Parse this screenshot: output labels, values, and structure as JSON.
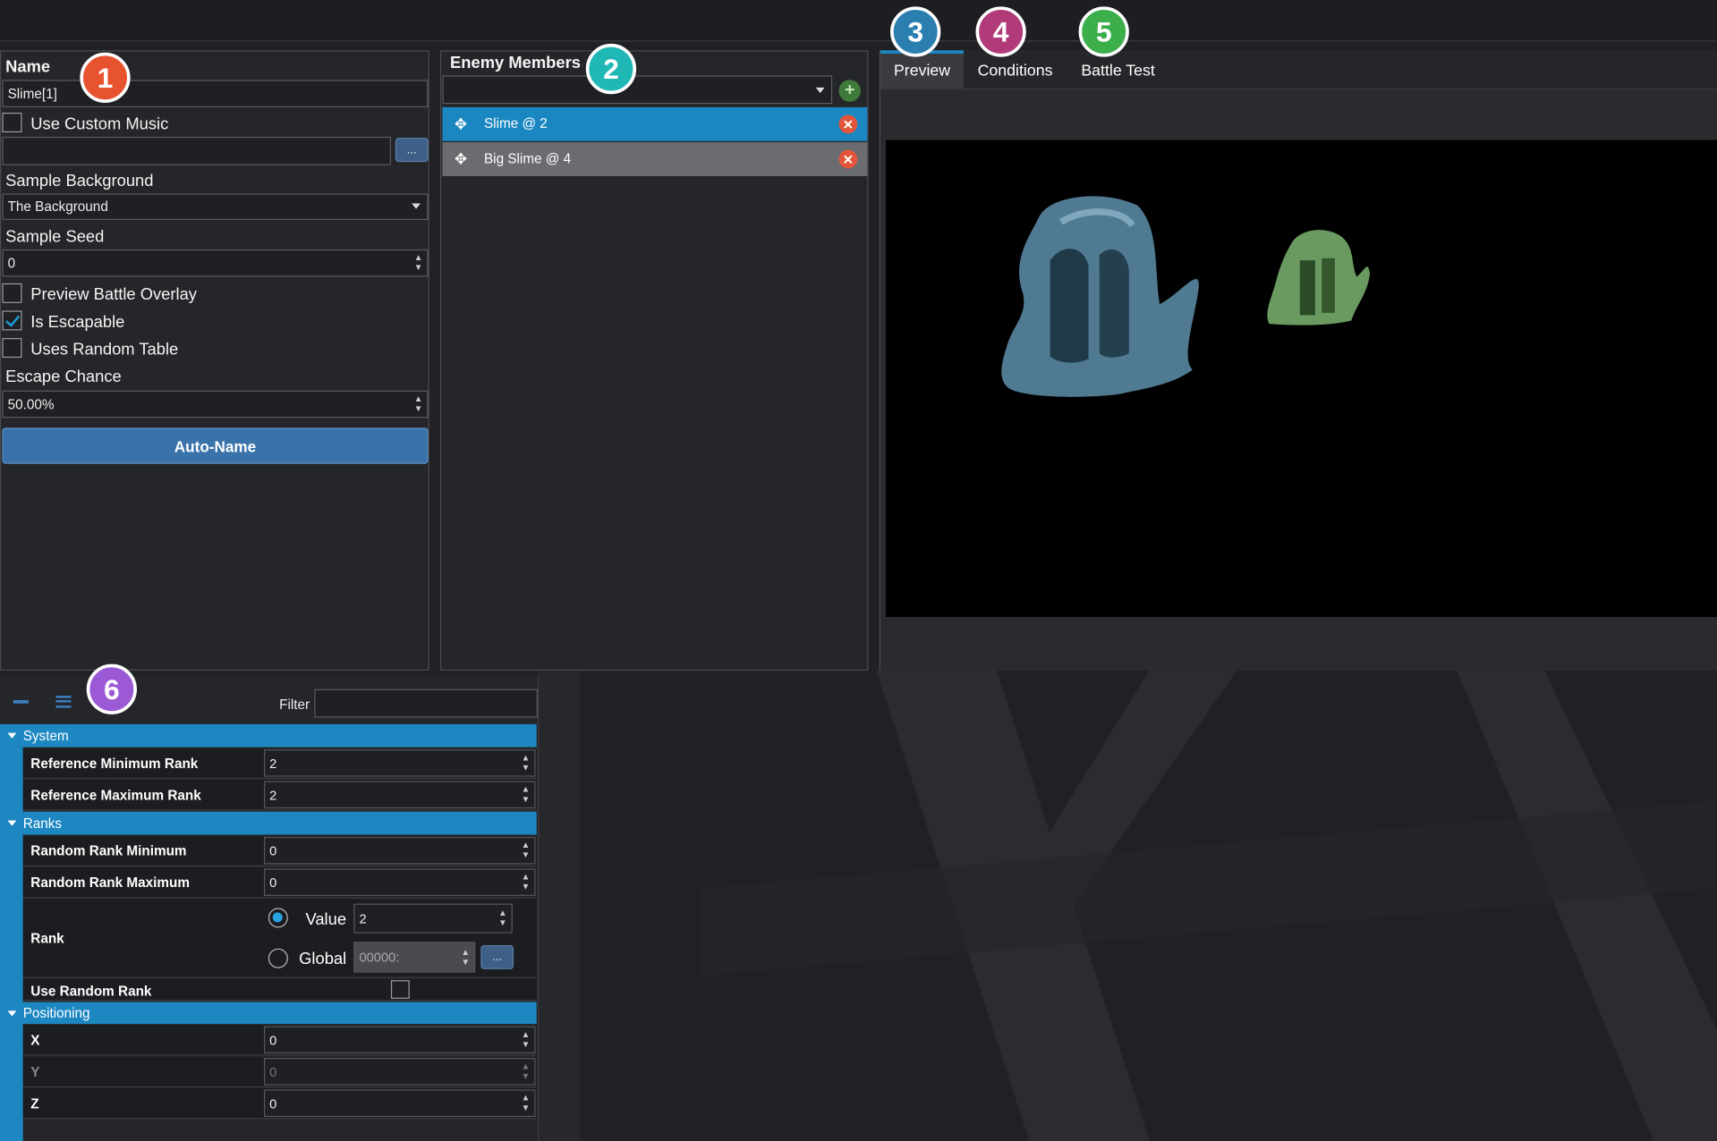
{
  "left_panel": {
    "name_label": "Name",
    "name_value": "Slime[1]",
    "use_custom_music_label": "Use Custom Music",
    "music_browse_label": "...",
    "sample_background_label": "Sample Background",
    "sample_background_value": "The Background",
    "sample_seed_label": "Sample Seed",
    "sample_seed_value": "0",
    "preview_battle_overlay_label": "Preview Battle Overlay",
    "is_escapable_label": "Is Escapable",
    "uses_random_table_label": "Uses Random Table",
    "escape_chance_label": "Escape Chance",
    "escape_chance_value": "50.00%",
    "auto_name_label": "Auto-Name",
    "use_custom_music_checked": false,
    "preview_battle_overlay_checked": false,
    "is_escapable_checked": true,
    "uses_random_table_checked": false
  },
  "members_panel": {
    "title": "Enemy Members",
    "dropdown_value": "",
    "members": [
      {
        "label": "Slime @ 2",
        "selected": true
      },
      {
        "label": "Big Slime @ 4",
        "selected": false
      }
    ]
  },
  "tabs": [
    {
      "label": "Preview",
      "active": true
    },
    {
      "label": "Conditions",
      "active": false
    },
    {
      "label": "Battle Test",
      "active": false
    }
  ],
  "badges": [
    {
      "number": "1",
      "color": "#e8532f"
    },
    {
      "number": "2",
      "color": "#1fb8b5"
    },
    {
      "number": "3",
      "color": "#2a7fb0"
    },
    {
      "number": "4",
      "color": "#b03b78"
    },
    {
      "number": "5",
      "color": "#3cae4a"
    },
    {
      "number": "6",
      "color": "#9b59d6"
    }
  ],
  "property_grid": {
    "filter_label": "Filter",
    "filter_value": "",
    "sections": {
      "system": "System",
      "ranks": "Ranks",
      "positioning": "Positioning"
    },
    "rows": {
      "ref_min_rank": {
        "name": "Reference Minimum Rank",
        "value": "2"
      },
      "ref_max_rank": {
        "name": "Reference Maximum Rank",
        "value": "2"
      },
      "random_rank_min": {
        "name": "Random Rank Minimum",
        "value": "0"
      },
      "random_rank_max": {
        "name": "Random Rank Maximum",
        "value": "0"
      },
      "rank": {
        "name": "Rank",
        "value_option": "Value",
        "value_value": "2",
        "global_option": "Global",
        "global_value": "00000:",
        "browse": "..."
      },
      "use_random_rank": {
        "name": "Use Random Rank"
      },
      "x": {
        "name": "X",
        "value": "0"
      },
      "y": {
        "name": "Y",
        "value": "0"
      },
      "z": {
        "name": "Z",
        "value": "0"
      }
    }
  },
  "colors": {
    "accent": "#1d87c2",
    "selected_row": "#1b87c0",
    "background": "#202124"
  }
}
